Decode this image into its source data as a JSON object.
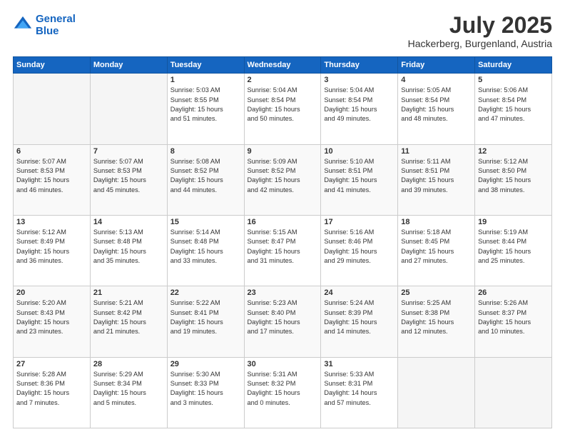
{
  "header": {
    "logo_line1": "General",
    "logo_line2": "Blue",
    "month_year": "July 2025",
    "location": "Hackerberg, Burgenland, Austria"
  },
  "days_of_week": [
    "Sunday",
    "Monday",
    "Tuesday",
    "Wednesday",
    "Thursday",
    "Friday",
    "Saturday"
  ],
  "weeks": [
    [
      {
        "day": "",
        "info": ""
      },
      {
        "day": "",
        "info": ""
      },
      {
        "day": "1",
        "info": "Sunrise: 5:03 AM\nSunset: 8:55 PM\nDaylight: 15 hours\nand 51 minutes."
      },
      {
        "day": "2",
        "info": "Sunrise: 5:04 AM\nSunset: 8:54 PM\nDaylight: 15 hours\nand 50 minutes."
      },
      {
        "day": "3",
        "info": "Sunrise: 5:04 AM\nSunset: 8:54 PM\nDaylight: 15 hours\nand 49 minutes."
      },
      {
        "day": "4",
        "info": "Sunrise: 5:05 AM\nSunset: 8:54 PM\nDaylight: 15 hours\nand 48 minutes."
      },
      {
        "day": "5",
        "info": "Sunrise: 5:06 AM\nSunset: 8:54 PM\nDaylight: 15 hours\nand 47 minutes."
      }
    ],
    [
      {
        "day": "6",
        "info": "Sunrise: 5:07 AM\nSunset: 8:53 PM\nDaylight: 15 hours\nand 46 minutes."
      },
      {
        "day": "7",
        "info": "Sunrise: 5:07 AM\nSunset: 8:53 PM\nDaylight: 15 hours\nand 45 minutes."
      },
      {
        "day": "8",
        "info": "Sunrise: 5:08 AM\nSunset: 8:52 PM\nDaylight: 15 hours\nand 44 minutes."
      },
      {
        "day": "9",
        "info": "Sunrise: 5:09 AM\nSunset: 8:52 PM\nDaylight: 15 hours\nand 42 minutes."
      },
      {
        "day": "10",
        "info": "Sunrise: 5:10 AM\nSunset: 8:51 PM\nDaylight: 15 hours\nand 41 minutes."
      },
      {
        "day": "11",
        "info": "Sunrise: 5:11 AM\nSunset: 8:51 PM\nDaylight: 15 hours\nand 39 minutes."
      },
      {
        "day": "12",
        "info": "Sunrise: 5:12 AM\nSunset: 8:50 PM\nDaylight: 15 hours\nand 38 minutes."
      }
    ],
    [
      {
        "day": "13",
        "info": "Sunrise: 5:12 AM\nSunset: 8:49 PM\nDaylight: 15 hours\nand 36 minutes."
      },
      {
        "day": "14",
        "info": "Sunrise: 5:13 AM\nSunset: 8:48 PM\nDaylight: 15 hours\nand 35 minutes."
      },
      {
        "day": "15",
        "info": "Sunrise: 5:14 AM\nSunset: 8:48 PM\nDaylight: 15 hours\nand 33 minutes."
      },
      {
        "day": "16",
        "info": "Sunrise: 5:15 AM\nSunset: 8:47 PM\nDaylight: 15 hours\nand 31 minutes."
      },
      {
        "day": "17",
        "info": "Sunrise: 5:16 AM\nSunset: 8:46 PM\nDaylight: 15 hours\nand 29 minutes."
      },
      {
        "day": "18",
        "info": "Sunrise: 5:18 AM\nSunset: 8:45 PM\nDaylight: 15 hours\nand 27 minutes."
      },
      {
        "day": "19",
        "info": "Sunrise: 5:19 AM\nSunset: 8:44 PM\nDaylight: 15 hours\nand 25 minutes."
      }
    ],
    [
      {
        "day": "20",
        "info": "Sunrise: 5:20 AM\nSunset: 8:43 PM\nDaylight: 15 hours\nand 23 minutes."
      },
      {
        "day": "21",
        "info": "Sunrise: 5:21 AM\nSunset: 8:42 PM\nDaylight: 15 hours\nand 21 minutes."
      },
      {
        "day": "22",
        "info": "Sunrise: 5:22 AM\nSunset: 8:41 PM\nDaylight: 15 hours\nand 19 minutes."
      },
      {
        "day": "23",
        "info": "Sunrise: 5:23 AM\nSunset: 8:40 PM\nDaylight: 15 hours\nand 17 minutes."
      },
      {
        "day": "24",
        "info": "Sunrise: 5:24 AM\nSunset: 8:39 PM\nDaylight: 15 hours\nand 14 minutes."
      },
      {
        "day": "25",
        "info": "Sunrise: 5:25 AM\nSunset: 8:38 PM\nDaylight: 15 hours\nand 12 minutes."
      },
      {
        "day": "26",
        "info": "Sunrise: 5:26 AM\nSunset: 8:37 PM\nDaylight: 15 hours\nand 10 minutes."
      }
    ],
    [
      {
        "day": "27",
        "info": "Sunrise: 5:28 AM\nSunset: 8:36 PM\nDaylight: 15 hours\nand 7 minutes."
      },
      {
        "day": "28",
        "info": "Sunrise: 5:29 AM\nSunset: 8:34 PM\nDaylight: 15 hours\nand 5 minutes."
      },
      {
        "day": "29",
        "info": "Sunrise: 5:30 AM\nSunset: 8:33 PM\nDaylight: 15 hours\nand 3 minutes."
      },
      {
        "day": "30",
        "info": "Sunrise: 5:31 AM\nSunset: 8:32 PM\nDaylight: 15 hours\nand 0 minutes."
      },
      {
        "day": "31",
        "info": "Sunrise: 5:33 AM\nSunset: 8:31 PM\nDaylight: 14 hours\nand 57 minutes."
      },
      {
        "day": "",
        "info": ""
      },
      {
        "day": "",
        "info": ""
      }
    ]
  ]
}
